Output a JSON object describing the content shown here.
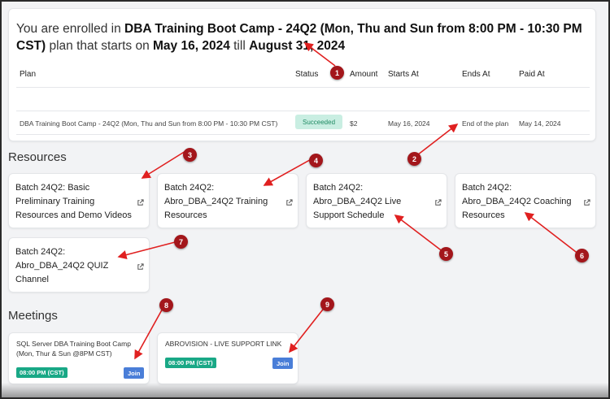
{
  "enrollment": {
    "prefix": "You are enrolled in",
    "course": "DBA Training Boot Camp - 24Q2 (Mon, Thu and Sun from 8:00 PM - 10:30 PM CST)",
    "mid": "plan that starts on",
    "start": "May 16, 2024",
    "till": "till",
    "end": "August 31, 2024"
  },
  "plan_table": {
    "headers": {
      "plan": "Plan",
      "status": "Status",
      "amount": "Amount",
      "starts_at": "Starts At",
      "ends_at": "Ends At",
      "paid_at": "Paid At"
    },
    "row": {
      "plan": "DBA Training Boot Camp - 24Q2 (Mon, Thu and Sun from 8:00 PM - 10:30 PM CST)",
      "status": "Succeeded",
      "amount": "$2",
      "starts_at": "May 16, 2024",
      "ends_at": "End of the plan",
      "paid_at": "May 14, 2024"
    }
  },
  "resources": {
    "title": "Resources",
    "items": [
      {
        "label": "Batch 24Q2: Basic Preliminary Training Resources and Demo Videos"
      },
      {
        "label": "Batch 24Q2: Abro_DBA_24Q2 Training Resources"
      },
      {
        "label": "Batch 24Q2: Abro_DBA_24Q2 Live Support Schedule"
      },
      {
        "label": "Batch 24Q2: Abro_DBA_24Q2 Coaching Resources"
      },
      {
        "label": "Batch 24Q2: Abro_DBA_24Q2 QUIZ Channel"
      }
    ]
  },
  "meetings": {
    "title": "Meetings",
    "items": [
      {
        "title": "SQL Server DBA Training Boot Camp (Mon, Thur & Sun @8PM CST)",
        "time": "08:00 PM (CST)",
        "join": "Join"
      },
      {
        "title": "ABROVISION - LIVE SUPPORT LINK",
        "time": "08:00 PM (CST)",
        "join": "Join"
      }
    ]
  },
  "annotations": {
    "color": "#a3161b",
    "markers": [
      "1",
      "2",
      "3",
      "4",
      "5",
      "6",
      "7",
      "8",
      "9"
    ]
  },
  "icons": {
    "external_link": "external-link-icon"
  }
}
